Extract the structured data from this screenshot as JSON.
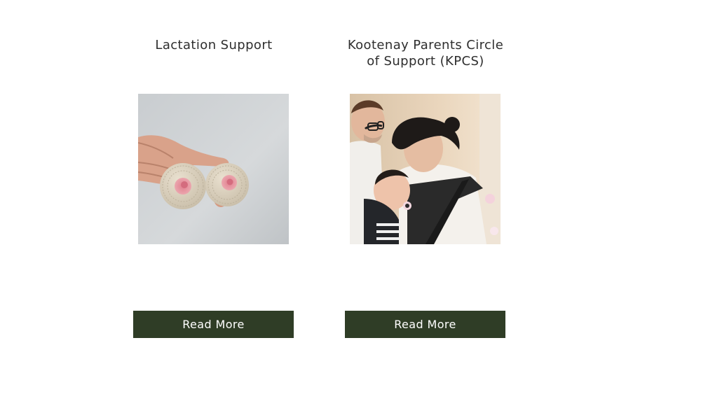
{
  "cards": [
    {
      "title": "Lactation Support",
      "image_alt": "Crocheted breast models held in a hand",
      "button_label": "Read More"
    },
    {
      "title": "Kootenay Parents Circle of Support (KPCS)",
      "image_alt": "Parents holding a baby in a carrier",
      "button_label": "Read More"
    }
  ],
  "colors": {
    "button_bg": "#2f3d26",
    "button_text": "#ffffff",
    "title_text": "#2e2e2e",
    "page_bg": "#ffffff"
  }
}
